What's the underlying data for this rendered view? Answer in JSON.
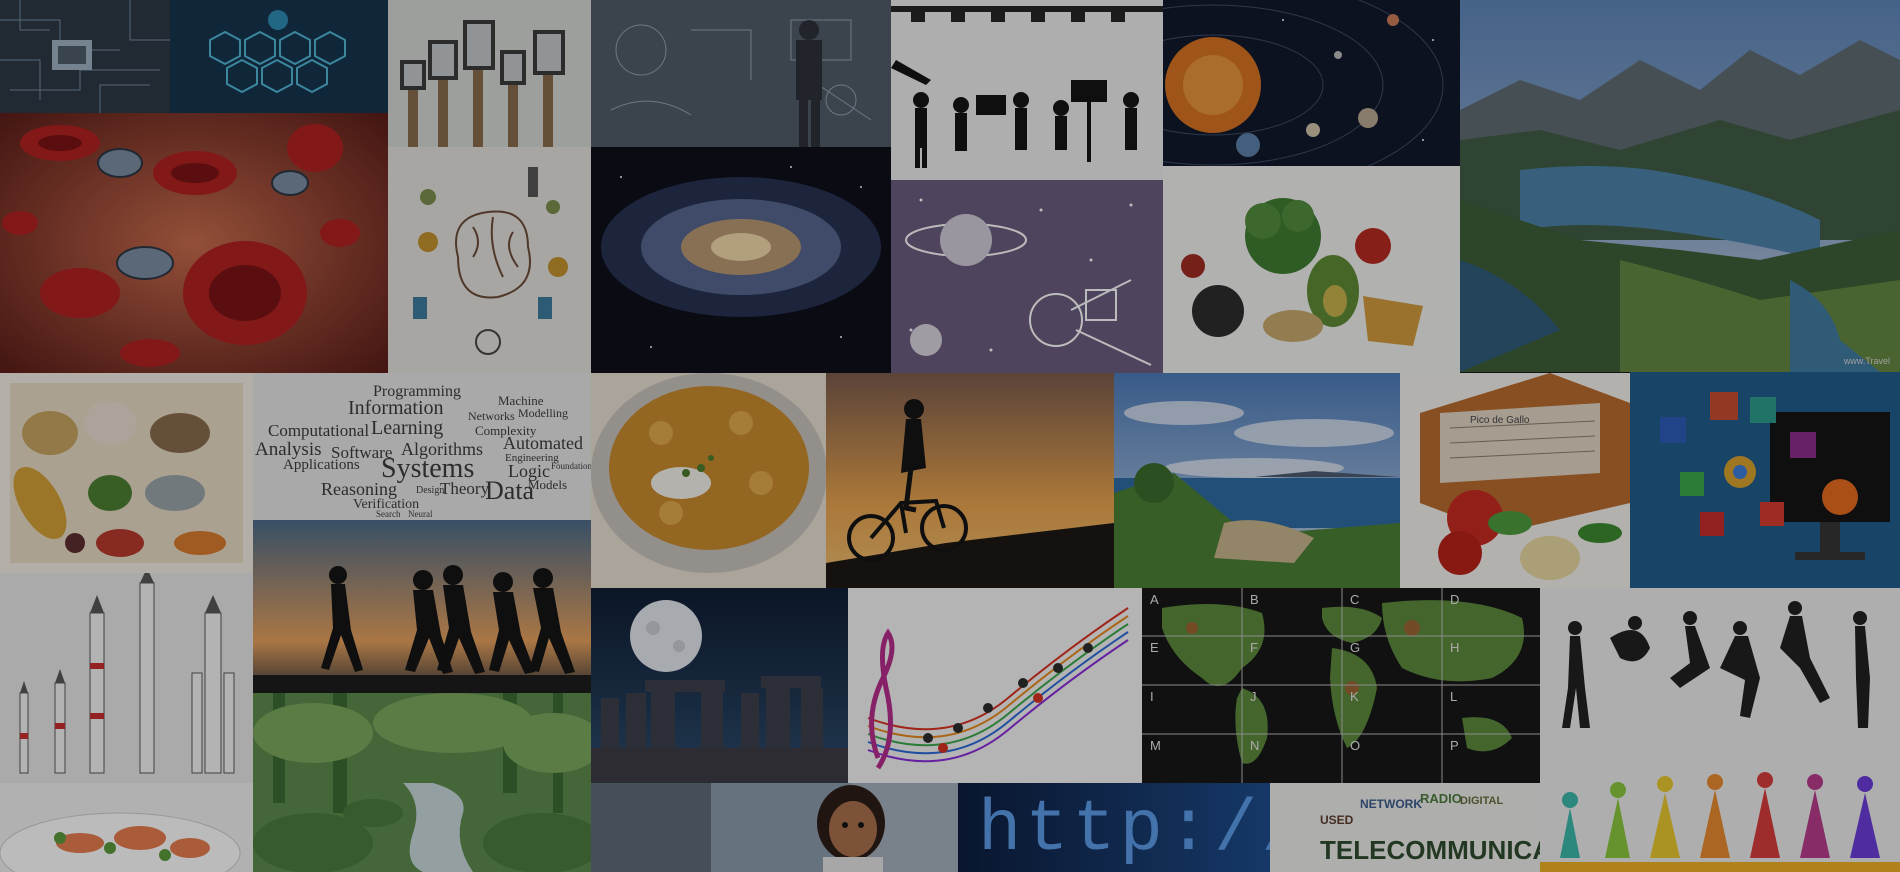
{
  "colors": {
    "overlay": "#0c0c10",
    "background": "#1a1a1e"
  },
  "word_cloud": {
    "words": [
      "Programming",
      "Information",
      "Machine",
      "Modelling",
      "Networks",
      "Learning",
      "Complexity",
      "Computational",
      "Automated",
      "Analysis",
      "Algorithms",
      "Engineering",
      "Applications",
      "Systems",
      "Logic",
      "Foundations",
      "Software",
      "Models",
      "Reasoning",
      "Design",
      "Theory",
      "Data",
      "Verification",
      "Search",
      "Neural"
    ]
  },
  "world_map": {
    "grid_letters": [
      "A",
      "B",
      "C",
      "D",
      "E",
      "F",
      "G",
      "H",
      "I",
      "J",
      "K",
      "L",
      "M",
      "N",
      "O",
      "P"
    ]
  },
  "file_box": {
    "label": "Pico de Gallo"
  },
  "telecom_cloud": {
    "main": "TELECOMMUNICATION",
    "words": [
      "RADIO",
      "DIGITAL",
      "NETWORK",
      "USED"
    ]
  },
  "url_banner": {
    "text": "http://ww"
  },
  "landscape_credit": {
    "text": "www.Travel"
  }
}
